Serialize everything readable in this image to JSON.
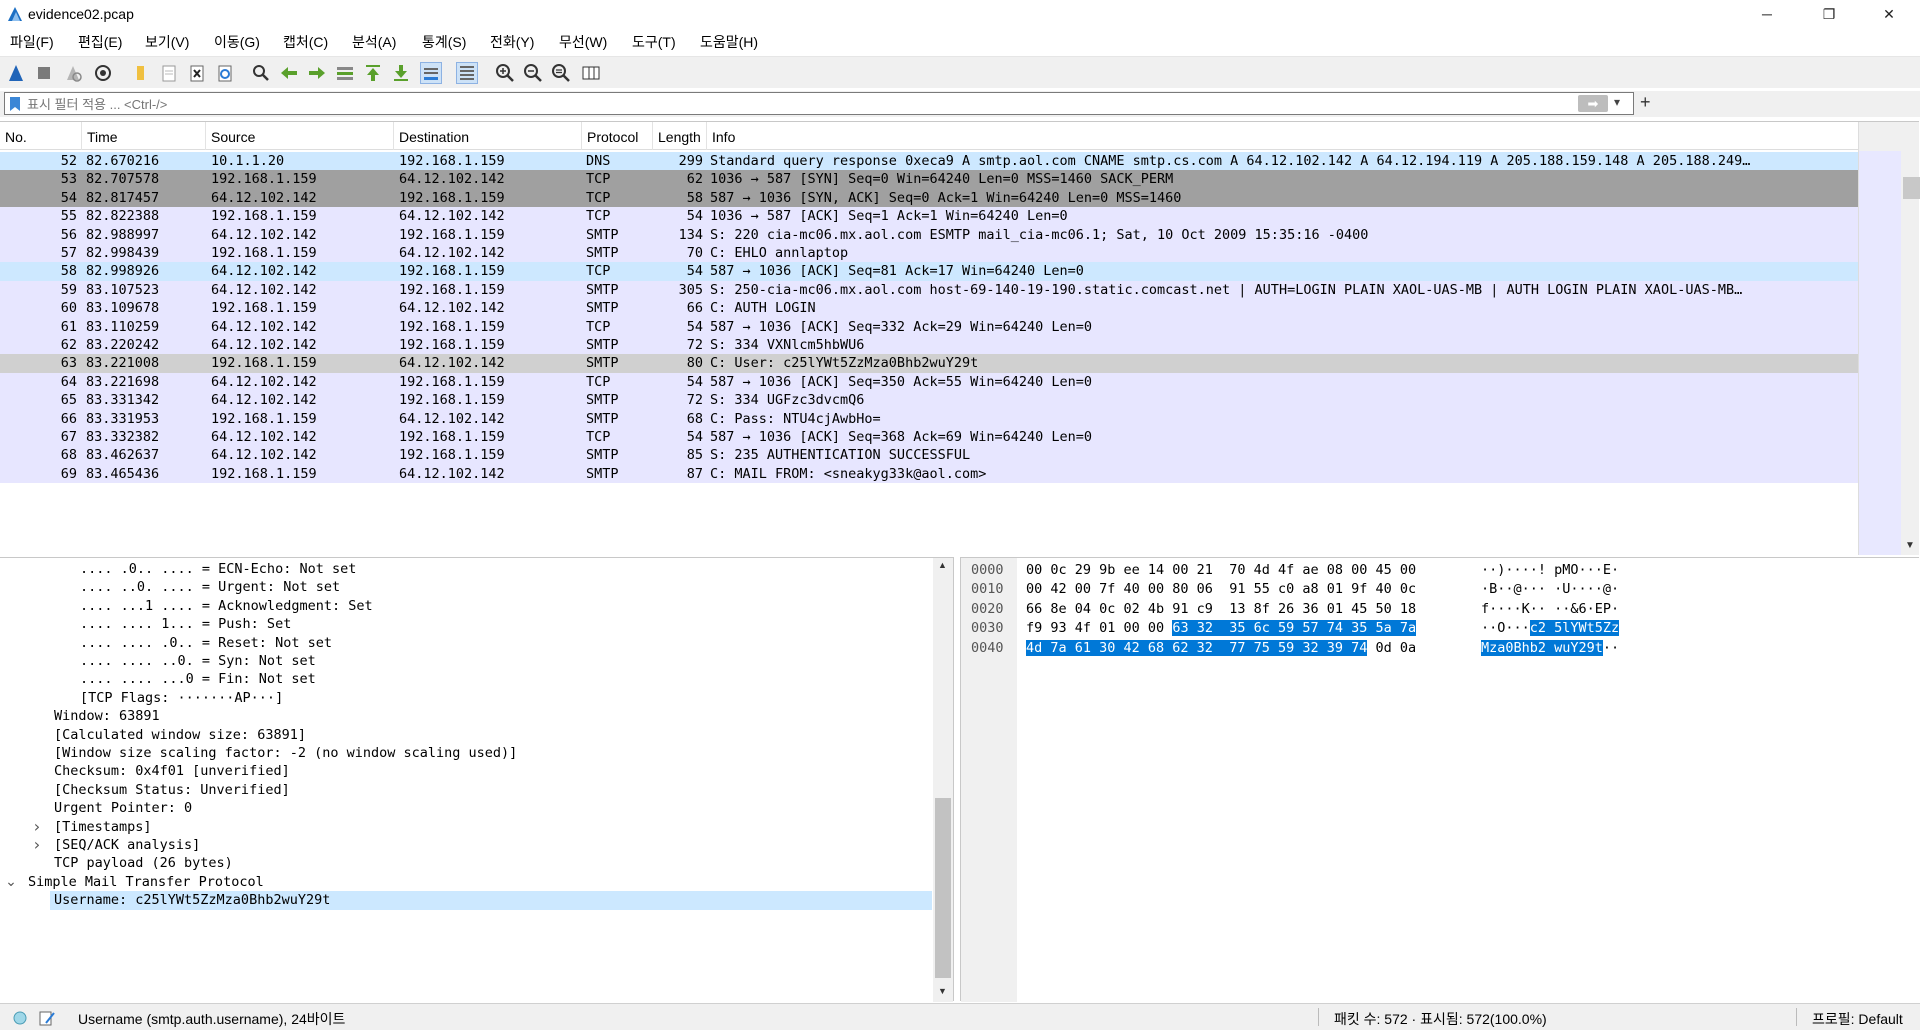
{
  "window": {
    "title": "evidence02.pcap",
    "minimize": "─",
    "maximize": "❐",
    "close": "✕"
  },
  "menu": [
    "파일(F)",
    "편집(E)",
    "보기(V)",
    "이동(G)",
    "캡처(C)",
    "분석(A)",
    "통계(S)",
    "전화(Y)",
    "무선(W)",
    "도구(T)",
    "도움말(H)"
  ],
  "filter": {
    "placeholder": "표시 필터 적용 ... <Ctrl-/>",
    "apply_icon": "➡",
    "dropdown_icon": "▾",
    "add_icon": "+"
  },
  "packet_list": {
    "columns": [
      "No.",
      "Time",
      "Source",
      "Destination",
      "Protocol",
      "Length",
      "Info"
    ],
    "rows": [
      {
        "no": "52",
        "time": "82.670216",
        "src": "10.1.1.20",
        "dst": "192.168.1.159",
        "proto": "DNS",
        "len": "299",
        "info": "Standard query response 0xeca9 A smtp.aol.com CNAME smtp.cs.com A 64.12.102.142 A 64.12.194.119 A 205.188.159.148 A 205.188.249…",
        "style": "selected-light"
      },
      {
        "no": "53",
        "time": "82.707578",
        "src": "192.168.1.159",
        "dst": "64.12.102.142",
        "proto": "TCP",
        "len": "62",
        "info": "1036 → 587 [SYN] Seq=0 Win=64240 Len=0 MSS=1460 SACK_PERM",
        "style": "syn"
      },
      {
        "no": "54",
        "time": "82.817457",
        "src": "64.12.102.142",
        "dst": "192.168.1.159",
        "proto": "TCP",
        "len": "58",
        "info": "587 → 1036 [SYN, ACK] Seq=0 Ack=1 Win=64240 Len=0 MSS=1460",
        "style": "syn"
      },
      {
        "no": "55",
        "time": "82.822388",
        "src": "192.168.1.159",
        "dst": "64.12.102.142",
        "proto": "TCP",
        "len": "54",
        "info": "1036 → 587 [ACK] Seq=1 Ack=1 Win=64240 Len=0",
        "style": "tcp"
      },
      {
        "no": "56",
        "time": "82.988997",
        "src": "64.12.102.142",
        "dst": "192.168.1.159",
        "proto": "SMTP",
        "len": "134",
        "info": "S: 220 cia-mc06.mx.aol.com ESMTP mail_cia-mc06.1; Sat, 10 Oct 2009 15:35:16 -0400",
        "style": "tcp"
      },
      {
        "no": "57",
        "time": "82.998439",
        "src": "192.168.1.159",
        "dst": "64.12.102.142",
        "proto": "SMTP",
        "len": "70",
        "info": "C: EHLO annlaptop",
        "style": "tcp"
      },
      {
        "no": "58",
        "time": "82.998926",
        "src": "64.12.102.142",
        "dst": "192.168.1.159",
        "proto": "TCP",
        "len": "54",
        "info": "587 → 1036 [ACK] Seq=81 Ack=17 Win=64240 Len=0",
        "style": "hover"
      },
      {
        "no": "59",
        "time": "83.107523",
        "src": "64.12.102.142",
        "dst": "192.168.1.159",
        "proto": "SMTP",
        "len": "305",
        "info": "S: 250-cia-mc06.mx.aol.com host-69-140-19-190.static.comcast.net | AUTH=LOGIN PLAIN XAOL-UAS-MB  | AUTH LOGIN PLAIN XAOL-UAS-MB…",
        "style": "tcp"
      },
      {
        "no": "60",
        "time": "83.109678",
        "src": "192.168.1.159",
        "dst": "64.12.102.142",
        "proto": "SMTP",
        "len": "66",
        "info": "C: AUTH LOGIN",
        "style": "tcp"
      },
      {
        "no": "61",
        "time": "83.110259",
        "src": "64.12.102.142",
        "dst": "192.168.1.159",
        "proto": "TCP",
        "len": "54",
        "info": "587 → 1036 [ACK] Seq=332 Ack=29 Win=64240 Len=0",
        "style": "tcp"
      },
      {
        "no": "62",
        "time": "83.220242",
        "src": "64.12.102.142",
        "dst": "192.168.1.159",
        "proto": "SMTP",
        "len": "72",
        "info": "S: 334 VXNlcm5hbWU6",
        "style": "tcp"
      },
      {
        "no": "63",
        "time": "83.221008",
        "src": "192.168.1.159",
        "dst": "64.12.102.142",
        "proto": "SMTP",
        "len": "80",
        "info": "C: User: c25lYWt5ZzMza0Bhb2wuY29t",
        "style": "selected"
      },
      {
        "no": "64",
        "time": "83.221698",
        "src": "64.12.102.142",
        "dst": "192.168.1.159",
        "proto": "TCP",
        "len": "54",
        "info": "587 → 1036 [ACK] Seq=350 Ack=55 Win=64240 Len=0",
        "style": "tcp"
      },
      {
        "no": "65",
        "time": "83.331342",
        "src": "64.12.102.142",
        "dst": "192.168.1.159",
        "proto": "SMTP",
        "len": "72",
        "info": "S: 334 UGFzc3dvcmQ6",
        "style": "tcp"
      },
      {
        "no": "66",
        "time": "83.331953",
        "src": "192.168.1.159",
        "dst": "64.12.102.142",
        "proto": "SMTP",
        "len": "68",
        "info": "C: Pass: NTU4cjAwbHo=",
        "style": "tcp"
      },
      {
        "no": "67",
        "time": "83.332382",
        "src": "64.12.102.142",
        "dst": "192.168.1.159",
        "proto": "TCP",
        "len": "54",
        "info": "587 → 1036 [ACK] Seq=368 Ack=69 Win=64240 Len=0",
        "style": "tcp"
      },
      {
        "no": "68",
        "time": "83.462637",
        "src": "64.12.102.142",
        "dst": "192.168.1.159",
        "proto": "SMTP",
        "len": "85",
        "info": "S: 235 AUTHENTICATION SUCCESSFUL",
        "style": "tcp"
      },
      {
        "no": "69",
        "time": "83.465436",
        "src": "192.168.1.159",
        "dst": "64.12.102.142",
        "proto": "SMTP",
        "len": "87",
        "info": "C: MAIL FROM: <sneakyg33k@aol.com>",
        "style": "tcp"
      }
    ]
  },
  "detail": {
    "rows": [
      {
        "indent": 80,
        "arrow": "",
        "text": ".... .0.. .... = ECN-Echo: Not set"
      },
      {
        "indent": 80,
        "arrow": "",
        "text": ".... ..0. .... = Urgent: Not set"
      },
      {
        "indent": 80,
        "arrow": "",
        "text": ".... ...1 .... = Acknowledgment: Set"
      },
      {
        "indent": 80,
        "arrow": "",
        "text": ".... .... 1... = Push: Set"
      },
      {
        "indent": 80,
        "arrow": "",
        "text": ".... .... .0.. = Reset: Not set"
      },
      {
        "indent": 80,
        "arrow": "",
        "text": ".... .... ..0. = Syn: Not set"
      },
      {
        "indent": 80,
        "arrow": "",
        "text": ".... .... ...0 = Fin: Not set"
      },
      {
        "indent": 80,
        "arrow": "",
        "text": "[TCP Flags: ·······AP···]"
      },
      {
        "indent": 54,
        "arrow": "",
        "text": "Window: 63891"
      },
      {
        "indent": 54,
        "arrow": "",
        "text": "[Calculated window size: 63891]"
      },
      {
        "indent": 54,
        "arrow": "",
        "text": "[Window size scaling factor: -2 (no window scaling used)]"
      },
      {
        "indent": 54,
        "arrow": "",
        "text": "Checksum: 0x4f01 [unverified]"
      },
      {
        "indent": 54,
        "arrow": "",
        "text": "[Checksum Status: Unverified]"
      },
      {
        "indent": 54,
        "arrow": "",
        "text": "Urgent Pointer: 0"
      },
      {
        "indent": 54,
        "arrow": ">",
        "text": "[Timestamps]"
      },
      {
        "indent": 54,
        "arrow": ">",
        "text": "[SEQ/ACK analysis]"
      },
      {
        "indent": 54,
        "arrow": "",
        "text": "TCP payload (26 bytes)"
      },
      {
        "indent": 28,
        "arrow": "v",
        "text": "Simple Mail Transfer Protocol"
      },
      {
        "indent": 54,
        "arrow": "",
        "text": "Username: c25lYWt5ZzMza0Bhb2wuY29t",
        "hl": true
      }
    ]
  },
  "bytes": {
    "rows": [
      {
        "off": "0000",
        "hex": [
          [
            "00 0c 29 9b ee 14 00 21  70 4d 4f ae 08 00 45 00",
            false
          ]
        ],
        "asc": [
          [
            "··)····! pMO···E·",
            false
          ]
        ]
      },
      {
        "off": "0010",
        "hex": [
          [
            "00 42 00 7f 40 00 80 06  91 55 c0 a8 01 9f 40 0c",
            false
          ]
        ],
        "asc": [
          [
            "·B··@··· ·U····@·",
            false
          ]
        ]
      },
      {
        "off": "0020",
        "hex": [
          [
            "66 8e 04 0c 02 4b 91 c9  13 8f 26 36 01 45 50 18",
            false
          ]
        ],
        "asc": [
          [
            "f····K·· ··&6·EP·",
            false
          ]
        ]
      },
      {
        "off": "0030",
        "hex": [
          [
            "f9 93 4f 01 00 00 ",
            false
          ],
          [
            "63 32  35 6c 59 57 74 35 5a 7a",
            true
          ]
        ],
        "asc": [
          [
            "··O···",
            false
          ],
          [
            "c2 5lYWt5Zz",
            true
          ]
        ]
      },
      {
        "off": "0040",
        "hex": [
          [
            "4d 7a 61 30 42 68 62 32  77 75 59 32 39 74",
            true
          ],
          [
            " 0d 0a",
            false
          ]
        ],
        "asc": [
          [
            "Mza0Bhb2 wuY29t",
            true
          ],
          [
            "··",
            false
          ]
        ]
      }
    ]
  },
  "status": {
    "field": "Username (smtp.auth.username), 24바이트",
    "packets": "패킷 수: 572 · 표시됨: 572(100.0%)",
    "profile": "프로필: Default"
  },
  "colors": {
    "row_tcp": "#e7e6ff",
    "row_syn": "#a0a0a0",
    "row_selected": "#d0d0d0",
    "row_selected_light": "#cde8ff",
    "row_hover": "#cde8ff",
    "accent": "#0078d7"
  }
}
